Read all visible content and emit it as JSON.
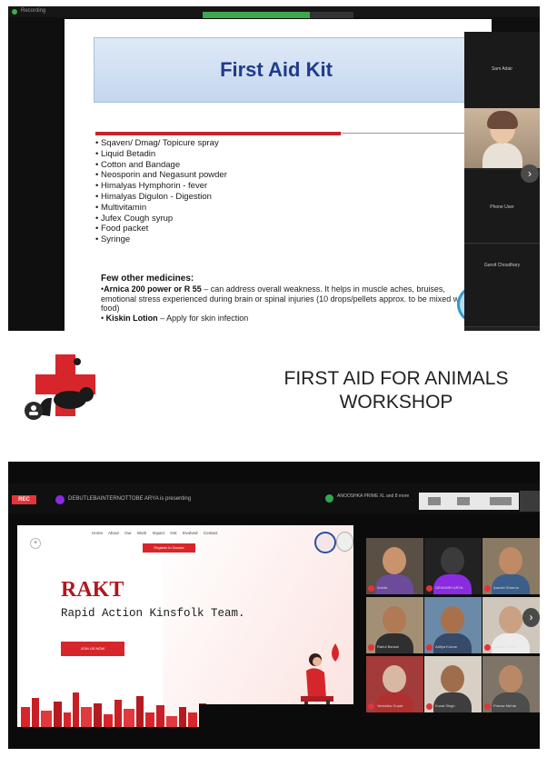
{
  "top_screenshot": {
    "recording_label": "Recording",
    "slide": {
      "title": "First Aid Kit",
      "items": [
        "Sqaven/ Dmag/ Topicure spray",
        "Liquid Betadin",
        "Cotton and Bandage",
        "Neosporin and Negasunt powder",
        "Himalyas Hymphorin - fever",
        "Himalyas Digulon - Digestion",
        "Multivitamin",
        "Jufex Cough syrup",
        "Food packet",
        "Syringe"
      ],
      "other_heading": "Few other medicines:",
      "other_lines": [
        {
          "name": "Arnica 200 power or R 55",
          "text": " – can address overall weakness. It helps in muscle aches, bruises, emotional stress experienced during brain or spinal injuries (10 drops/pellets approx. to be mixed with food)"
        },
        {
          "name": "Kiskin Lotion",
          "text": " – Apply for skin infection"
        }
      ]
    },
    "participants": [
      {
        "name": "Sam Adair"
      },
      {
        "name": "Phone User"
      },
      {
        "name": "Garvit Choudhary"
      }
    ],
    "banner_title_line1": "FIRST AID FOR ANIMALS",
    "banner_title_line2": "WORKSHOP",
    "colors": {
      "brand_red": "#d7262b",
      "title_blue": "#1f3b8a"
    }
  },
  "bottom_screenshot": {
    "rec_label": "REC",
    "presenting_text": "DEBUTLEBAINTERNOTTOBE ARYA is presenting",
    "host_text": "ANOOSHKA PRIME XL and 8 more",
    "site": {
      "nav": [
        "Home",
        "About",
        "Our Work",
        "Impact",
        "Get Involved",
        "Contact"
      ],
      "nav_button": "Register to Donate",
      "brand": "RAKT",
      "tagline": "Rapid Action Kinsfolk Team.",
      "cta": "JOIN US NOW"
    },
    "gallery": [
      {
        "name": "Ankita",
        "face": "#c9946d",
        "body": "#6b4b9a",
        "bg": "#5a4f45"
      },
      {
        "name": "DEVANSH ARYA",
        "face": "#3b3b3b",
        "body": "#8a2be2",
        "bg": "#222"
      },
      {
        "name": "Aarush Sharma",
        "face": "#c08a64",
        "body": "#3b5f8a",
        "bg": "#8a7a63"
      },
      {
        "name": "Rahul Bansal",
        "face": "#b07a54",
        "body": "#2f2f2f",
        "bg": "#a38f74"
      },
      {
        "name": "Aditya Kumar",
        "face": "#a8714c",
        "body": "#374a6a",
        "bg": "#6a8aa8"
      },
      {
        "name": "Ishaan Verma",
        "face": "#caa183",
        "body": "#ececec",
        "bg": "#cfc7bb"
      },
      {
        "name": "Vanshika Gupta",
        "face": "#d9b8a3",
        "body": "#b03030",
        "bg": "#a33b3b"
      },
      {
        "name": "Kunal Singh",
        "face": "#a06d4c",
        "body": "#3e3e3e",
        "bg": "#d8d0c5"
      },
      {
        "name": "Pranav Mehta",
        "face": "#b98866",
        "body": "#4d4d4d",
        "bg": "#7f7468"
      }
    ]
  }
}
